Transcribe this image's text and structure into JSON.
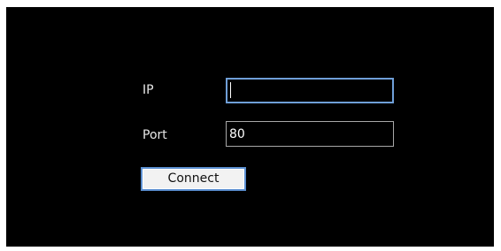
{
  "form": {
    "ip_label": "IP",
    "ip_value": "",
    "port_label": "Port",
    "port_value": "80",
    "connect_label": "Connect"
  },
  "colors": {
    "window_background": "#000000",
    "focused_field_border": "#6f9fd8",
    "button_border": "#5b8fd0",
    "text": "#e8e8e8"
  }
}
